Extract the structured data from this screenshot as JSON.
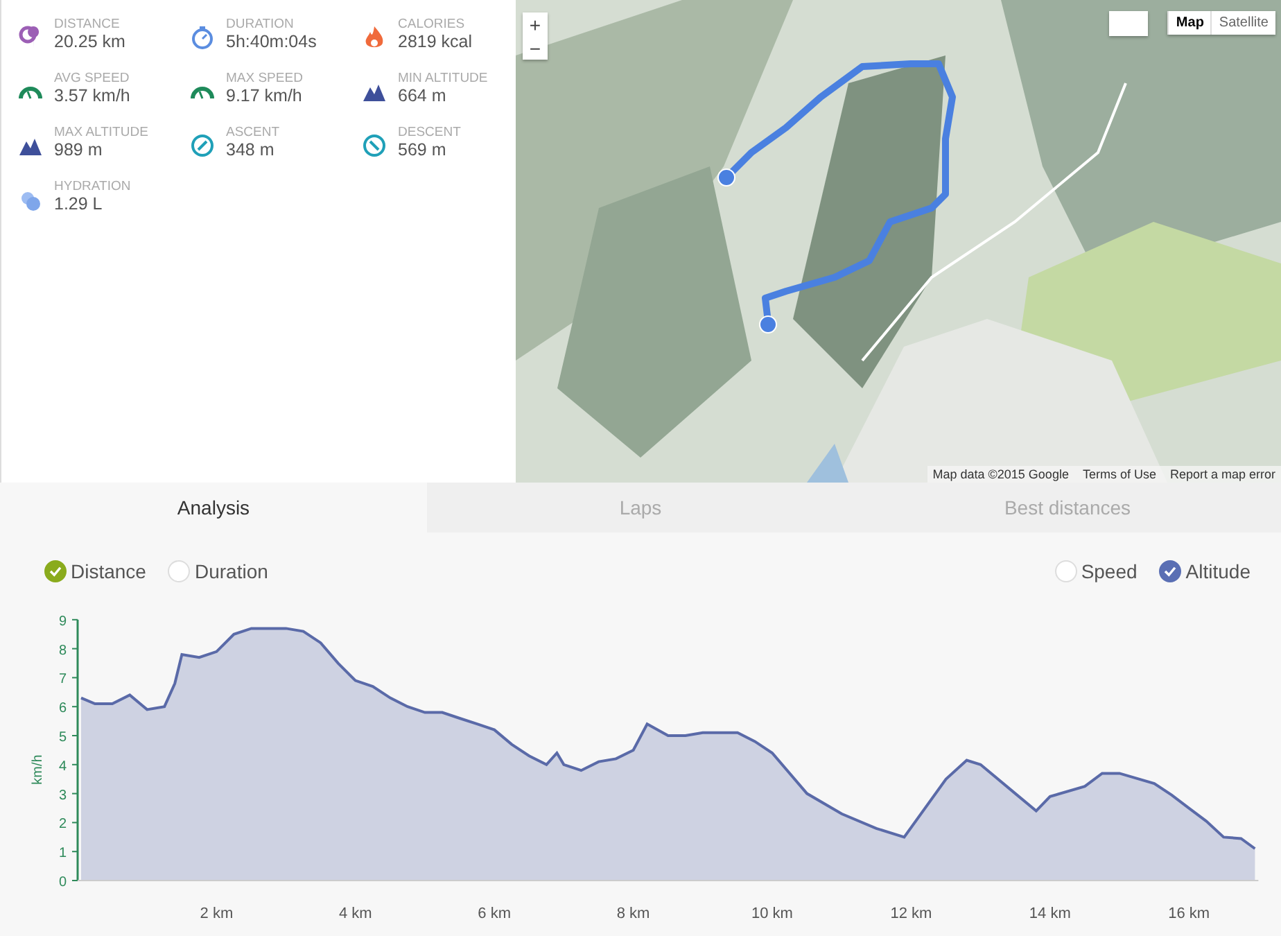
{
  "stats": [
    {
      "kind": "distance",
      "label": "DISTANCE",
      "value": "20.25 km"
    },
    {
      "kind": "duration",
      "label": "DURATION",
      "value": "5h:40m:04s"
    },
    {
      "kind": "calories",
      "label": "CALORIES",
      "value": "2819 kcal"
    },
    {
      "kind": "speed",
      "label": "AVG SPEED",
      "value": "3.57 km/h"
    },
    {
      "kind": "speed",
      "label": "MAX SPEED",
      "value": "9.17 km/h"
    },
    {
      "kind": "altitude",
      "label": "MIN ALTITUDE",
      "value": "664 m"
    },
    {
      "kind": "altitude",
      "label": "MAX ALTITUDE",
      "value": "989 m"
    },
    {
      "kind": "ascent",
      "label": "ASCENT",
      "value": "348 m"
    },
    {
      "kind": "descent",
      "label": "DESCENT",
      "value": "569 m"
    },
    {
      "kind": "hydration",
      "label": "HYDRATION",
      "value": "1.29 L"
    }
  ],
  "map": {
    "kind": "picture",
    "zoom_buttons": [
      "+",
      "−"
    ],
    "map_types": [
      {
        "label": "Map",
        "selected": true
      },
      {
        "label": "Satellite",
        "selected": false
      }
    ],
    "attribution": [
      "Map data ©2015 Google",
      "Terms of Use",
      "Report a map error"
    ]
  },
  "tabs": [
    {
      "label": "Analysis",
      "selected": true
    },
    {
      "label": "Laps",
      "selected": false
    },
    {
      "label": "Best distances",
      "selected": false
    }
  ],
  "x_options": [
    {
      "label": "Distance",
      "checked": true,
      "color": "#8aab1d"
    },
    {
      "label": "Duration",
      "checked": false
    }
  ],
  "y_options": [
    {
      "label": "Speed",
      "checked": false
    },
    {
      "label": "Altitude",
      "checked": true,
      "color": "#5a6fb4"
    }
  ],
  "chart": {
    "chart_data": {
      "type": "area",
      "ylabel": "km/h",
      "xlim": [
        0,
        17
      ],
      "ylim": [
        0,
        9
      ],
      "xticks": [
        {
          "value": 2,
          "label": "2 km"
        },
        {
          "value": 4,
          "label": "4 km"
        },
        {
          "value": 6,
          "label": "6 km"
        },
        {
          "value": 8,
          "label": "8 km"
        },
        {
          "value": 10,
          "label": "10 km"
        },
        {
          "value": 12,
          "label": "12 km"
        },
        {
          "value": 14,
          "label": "14 km"
        },
        {
          "value": 16,
          "label": "16 km"
        }
      ],
      "yticks": [
        0,
        1,
        2,
        3,
        4,
        5,
        6,
        7,
        8,
        9
      ],
      "x": [
        0.05,
        0.25,
        0.5,
        0.75,
        1.0,
        1.25,
        1.4,
        1.5,
        1.75,
        2.0,
        2.25,
        2.5,
        3.0,
        3.25,
        3.5,
        3.75,
        4.0,
        4.25,
        4.5,
        4.75,
        5.0,
        5.25,
        5.5,
        5.75,
        6.0,
        6.25,
        6.5,
        6.75,
        6.9,
        7.0,
        7.25,
        7.5,
        7.75,
        8.0,
        8.2,
        8.5,
        8.75,
        9.0,
        9.5,
        9.75,
        10.0,
        10.5,
        11.0,
        11.5,
        11.9,
        12.5,
        12.8,
        13.0,
        13.5,
        13.8,
        14.0,
        14.5,
        14.75,
        15.0,
        15.5,
        15.75,
        16.0,
        16.25,
        16.5,
        16.75,
        16.95
      ],
      "series": [
        {
          "color": "#5a6aa8",
          "values": [
            6.3,
            6.1,
            6.1,
            6.4,
            5.9,
            6.0,
            6.8,
            7.8,
            7.7,
            7.9,
            8.5,
            8.7,
            8.7,
            8.6,
            8.2,
            7.5,
            6.9,
            6.7,
            6.3,
            6.0,
            5.8,
            5.8,
            5.6,
            5.4,
            5.2,
            4.7,
            4.3,
            4.0,
            4.4,
            4.0,
            3.8,
            4.1,
            4.2,
            4.5,
            5.4,
            5.0,
            5.0,
            5.1,
            5.1,
            4.8,
            4.4,
            3.0,
            2.3,
            1.8,
            1.5,
            3.5,
            4.15,
            4.0,
            3.0,
            2.4,
            2.9,
            3.25,
            3.7,
            3.7,
            3.35,
            2.95,
            2.5,
            2.05,
            1.5,
            1.45,
            1.1
          ]
        }
      ]
    }
  }
}
